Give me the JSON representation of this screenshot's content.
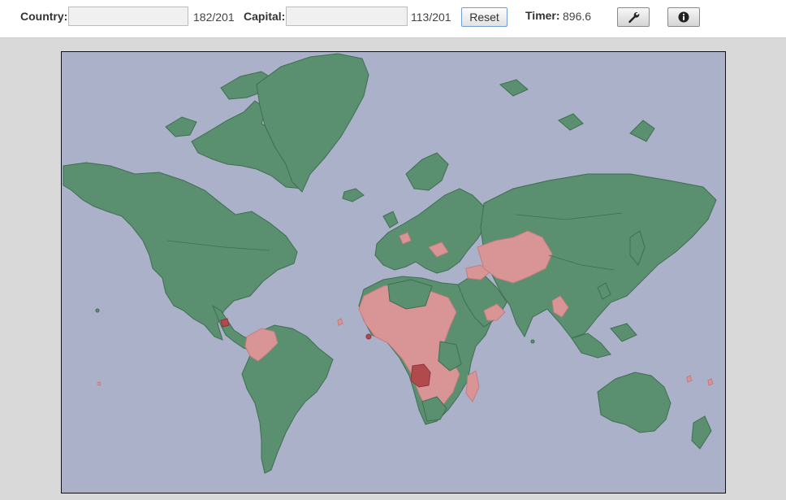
{
  "toolbar": {
    "country_label": "Country:",
    "country_value": "",
    "country_count": "182/201",
    "capital_label": "Capital:",
    "capital_value": "",
    "capital_count": "113/201",
    "reset_label": "Reset",
    "timer_label": "Timer:",
    "timer_value": "896.6",
    "settings_icon": "wrench-icon",
    "info_icon": "info-icon"
  },
  "map": {
    "status_colors": {
      "found": "#5a8f6f",
      "not_found": "#d99596",
      "selected": "#b04a4c",
      "ocean": "#aab1c9"
    }
  }
}
